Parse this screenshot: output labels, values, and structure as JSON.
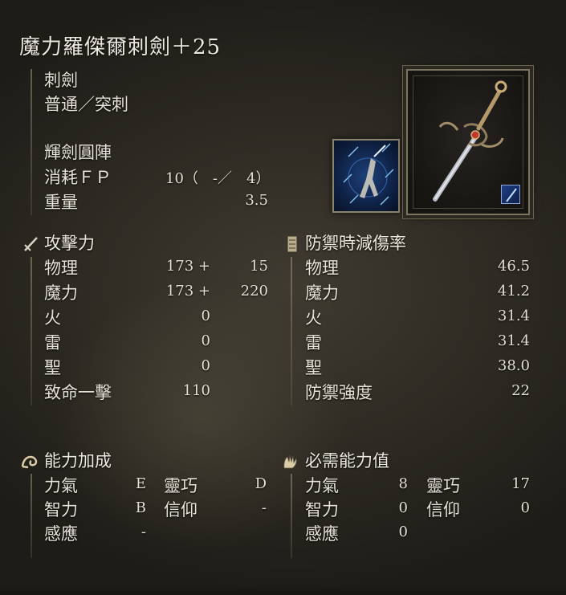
{
  "title": "魔力羅傑爾刺劍＋25",
  "weapon": {
    "type": "刺劍",
    "attack_type": "普通／突刺",
    "skill_name": "輝劍圓陣",
    "fp_label": "消耗ＦＰ",
    "fp_value": "10（　-／　4）",
    "weight_label": "重量",
    "weight_value": "3.5",
    "weapon_icon": "rapier-icon",
    "skill_icon": "glintblade-phalanx-icon",
    "affinity_icon": "magic-affinity-icon"
  },
  "attack": {
    "header": "攻擊力",
    "icon": "sword-icon",
    "rows": [
      {
        "label": "物理",
        "base": "173 +",
        "bonus": "15"
      },
      {
        "label": "魔力",
        "base": "173 +",
        "bonus": "220"
      },
      {
        "label": "火",
        "base": "0",
        "bonus": ""
      },
      {
        "label": "雷",
        "base": "0",
        "bonus": ""
      },
      {
        "label": "聖",
        "base": "0",
        "bonus": ""
      },
      {
        "label": "致命一擊",
        "base": "110",
        "bonus": ""
      }
    ]
  },
  "guard": {
    "header": "防禦時減傷率",
    "icon": "shield-icon",
    "rows": [
      {
        "label": "物理",
        "value": "46.5"
      },
      {
        "label": "魔力",
        "value": "41.2"
      },
      {
        "label": "火",
        "value": "31.4"
      },
      {
        "label": "雷",
        "value": "31.4"
      },
      {
        "label": "聖",
        "value": "38.0"
      },
      {
        "label": "防禦強度",
        "value": "22"
      }
    ]
  },
  "scaling": {
    "header": "能力加成",
    "icon": "arm-icon",
    "rows": [
      {
        "label1": "力氣",
        "value1": "E",
        "label2": "靈巧",
        "value2": "D"
      },
      {
        "label1": "智力",
        "value1": "B",
        "label2": "信仰",
        "value2": "-"
      },
      {
        "label1": "感應",
        "value1": "-",
        "label2": "",
        "value2": ""
      }
    ]
  },
  "requirements": {
    "header": "必需能力值",
    "icon": "hand-icon",
    "rows": [
      {
        "label1": "力氣",
        "value1": "8",
        "label2": "靈巧",
        "value2": "17"
      },
      {
        "label1": "智力",
        "value1": "0",
        "label2": "信仰",
        "value2": "0"
      },
      {
        "label1": "感應",
        "value1": "0",
        "label2": "",
        "value2": ""
      }
    ]
  },
  "colors": {
    "text": "#e6e2d7",
    "background": "#2d2a23",
    "frame": "#7a735f",
    "magic_blue": "#1d3f7a"
  }
}
